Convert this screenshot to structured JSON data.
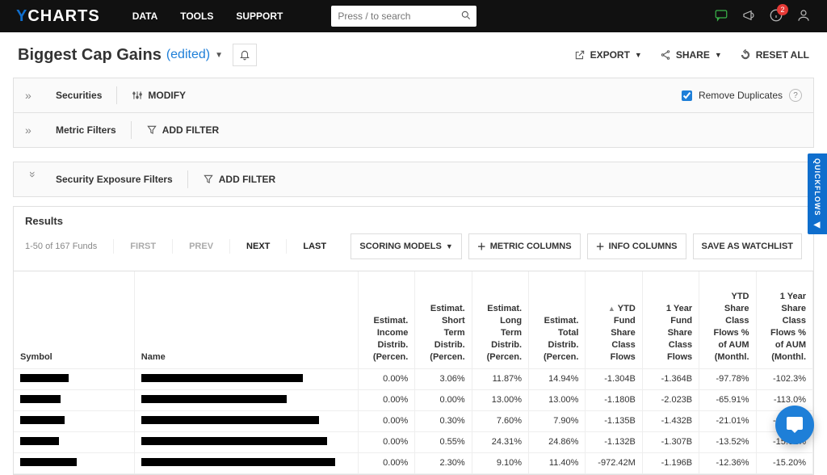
{
  "nav": {
    "links": [
      "DATA",
      "TOOLS",
      "SUPPORT"
    ],
    "search_placeholder": "Press / to search",
    "notif_count": "2"
  },
  "title": {
    "name": "Biggest Cap Gains",
    "edited": "(edited)"
  },
  "actions": {
    "export": "EXPORT",
    "share": "SHARE",
    "reset": "RESET ALL"
  },
  "filters": {
    "securities": "Securities",
    "modify": "MODIFY",
    "remove_dup": "Remove Duplicates",
    "metric": "Metric Filters",
    "add_filter": "ADD FILTER",
    "exposure": "Security Exposure Filters"
  },
  "results": {
    "label": "Results",
    "count": "1-50 of 167 Funds",
    "first": "FIRST",
    "prev": "PREV",
    "next": "NEXT",
    "last": "LAST",
    "scoring": "SCORING MODELS",
    "metric_cols": "METRIC COLUMNS",
    "info_cols": "INFO COLUMNS",
    "save": "SAVE AS WATCHLIST"
  },
  "columns": {
    "symbol": "Symbol",
    "name": "Name",
    "c1": "Estimat. Income Distrib. (Percen.",
    "c2": "Estimat. Short Term Distrib. (Percen.",
    "c3": "Estimat. Long Term Distrib. (Percen.",
    "c4": "Estimat. Total Distrib. (Percen.",
    "c5": "YTD Fund Share Class Flows",
    "c6": "1 Year Fund Share Class Flows",
    "c7": "YTD Share Class Flows % of AUM (Monthl.",
    "c8": "1 Year Share Class Flows % of AUM (Monthl."
  },
  "rows": [
    {
      "barA": 60,
      "barB": 200,
      "c1": "0.00%",
      "c2": "3.06%",
      "c3": "11.87%",
      "c4": "14.94%",
      "c5": "-1.304B",
      "c6": "-1.364B",
      "c7": "-97.78%",
      "c8": "-102.3%"
    },
    {
      "barA": 50,
      "barB": 180,
      "c1": "0.00%",
      "c2": "0.00%",
      "c3": "13.00%",
      "c4": "13.00%",
      "c5": "-1.180B",
      "c6": "-2.023B",
      "c7": "-65.91%",
      "c8": "-113.0%"
    },
    {
      "barA": 55,
      "barB": 220,
      "c1": "0.00%",
      "c2": "0.30%",
      "c3": "7.60%",
      "c4": "7.90%",
      "c5": "-1.135B",
      "c6": "-1.432B",
      "c7": "-21.01%",
      "c8": "-26.50%"
    },
    {
      "barA": 48,
      "barB": 230,
      "c1": "0.00%",
      "c2": "0.55%",
      "c3": "24.31%",
      "c4": "24.86%",
      "c5": "-1.132B",
      "c6": "-1.307B",
      "c7": "-13.52%",
      "c8": "-15.61%"
    },
    {
      "barA": 70,
      "barB": 240,
      "c1": "0.00%",
      "c2": "2.30%",
      "c3": "9.10%",
      "c4": "11.40%",
      "c5": "-972.42M",
      "c6": "-1.196B",
      "c7": "-12.36%",
      "c8": "-15.20%"
    }
  ],
  "quickflows": "QUICKFLOWS"
}
